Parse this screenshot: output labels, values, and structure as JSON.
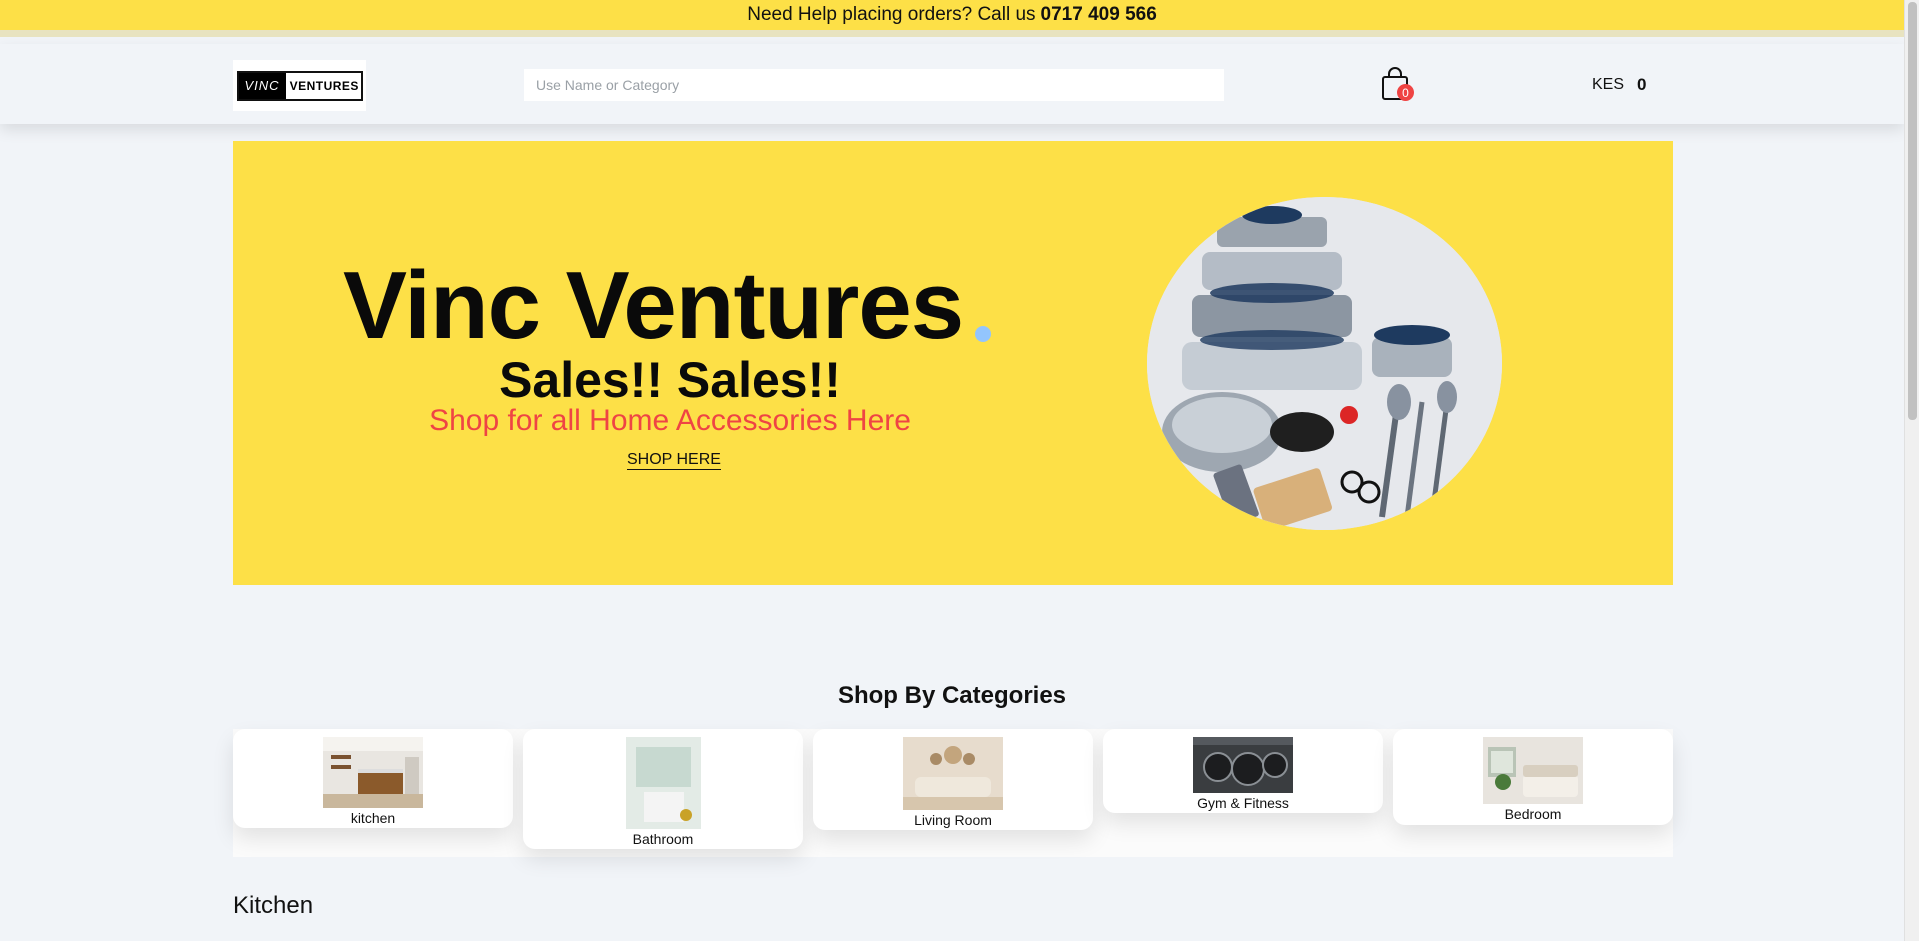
{
  "topbar": {
    "help_text": "Need Help placing orders? Call us",
    "phone": "0717 409 566",
    "background": "#fde047"
  },
  "header": {
    "logo": {
      "left_text": "VINC",
      "right_text": "VENTURES"
    },
    "search": {
      "placeholder": "Use Name or Category",
      "value": ""
    },
    "cart": {
      "icon": "shopping-bag-icon",
      "count": "0"
    },
    "currency": "KES",
    "total": "0"
  },
  "hero": {
    "title": "Vinc Ventures",
    "subtitle": "Sales!! Sales!!",
    "tagline": "Shop for all Home Accessories Here",
    "cta": "SHOP HERE",
    "image": "cookware-set-image",
    "accent_color": "#ef4444"
  },
  "categories": {
    "title": "Shop By Categories",
    "items": [
      {
        "label": "kitchen",
        "image": "kitchen-image"
      },
      {
        "label": "Bathroom",
        "image": "bathroom-image"
      },
      {
        "label": "Living Room",
        "image": "living-room-image"
      },
      {
        "label": "Gym & Fitness",
        "image": "gym-image"
      },
      {
        "label": "Bedroom",
        "image": "bedroom-image"
      }
    ]
  },
  "section": {
    "title": "Kitchen"
  }
}
